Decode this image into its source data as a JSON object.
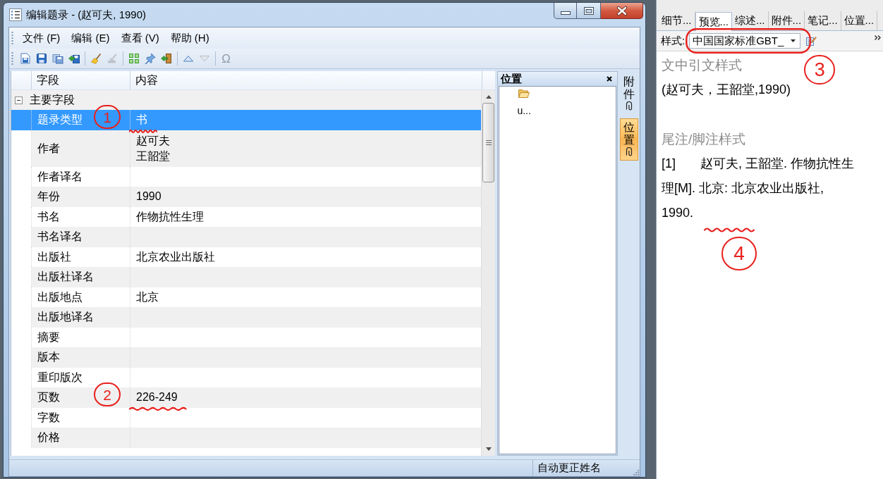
{
  "window": {
    "title": "编辑题录 - (赵可夫, 1990)"
  },
  "menu": [
    {
      "label": "文件 (F)"
    },
    {
      "label": "编辑 (E)"
    },
    {
      "label": "查看 (V)"
    },
    {
      "label": "帮助 (H)"
    }
  ],
  "toolbar": [
    {
      "kind": "new",
      "disabled": false
    },
    {
      "kind": "save",
      "disabled": false
    },
    {
      "kind": "copy",
      "disabled": false
    },
    {
      "kind": "saveclose",
      "disabled": false
    },
    {
      "kind": "separator"
    },
    {
      "kind": "clean",
      "disabled": false
    },
    {
      "kind": "stamp",
      "disabled": true
    },
    {
      "kind": "separator"
    },
    {
      "kind": "grid",
      "disabled": false
    },
    {
      "kind": "pin",
      "disabled": false
    },
    {
      "kind": "exit",
      "disabled": false
    },
    {
      "kind": "separator"
    },
    {
      "kind": "up",
      "disabled": false
    },
    {
      "kind": "down",
      "disabled": true
    },
    {
      "kind": "separator"
    },
    {
      "kind": "symbol",
      "glyph": "Ω",
      "disabled": true
    }
  ],
  "table": {
    "columns": [
      "字段",
      "内容"
    ],
    "group": {
      "label": "主要字段",
      "expanded": true
    },
    "rows": [
      {
        "field": "题录类型",
        "values": [
          "书"
        ],
        "selected": true,
        "annotation": "1"
      },
      {
        "field": "作者",
        "values": [
          "赵可夫",
          "王韶堂"
        ],
        "selected": false
      },
      {
        "field": "作者译名",
        "selected": false
      },
      {
        "field": "年份",
        "values": [
          "1990"
        ],
        "selected": false
      },
      {
        "field": "书名",
        "values": [
          "作物抗性生理"
        ],
        "selected": false
      },
      {
        "field": "书名译名",
        "selected": false
      },
      {
        "field": "出版社",
        "values": [
          "北京农业出版社"
        ],
        "selected": false
      },
      {
        "field": "出版社译名",
        "selected": false
      },
      {
        "field": "出版地点",
        "values": [
          "北京"
        ],
        "selected": false
      },
      {
        "field": "出版地译名",
        "selected": false
      },
      {
        "field": "摘要",
        "selected": false
      },
      {
        "field": "版本",
        "selected": false
      },
      {
        "field": "重印版次",
        "selected": false
      },
      {
        "field": "页数",
        "values": [
          "226-249"
        ],
        "selected": false,
        "annotation": "2"
      },
      {
        "field": "字数",
        "selected": false
      },
      {
        "field": "价格",
        "selected": false
      }
    ]
  },
  "location_panel": {
    "title": "位置",
    "items": [
      {
        "label": "u..."
      }
    ]
  },
  "side_tabs": [
    {
      "label": "附件",
      "selected": false
    },
    {
      "label": "位置",
      "selected": true
    }
  ],
  "status_bar": {
    "text": "自动更正姓名"
  },
  "preview": {
    "tabs": [
      {
        "label": "细节...",
        "selected": false
      },
      {
        "label": "预览...",
        "selected": true
      },
      {
        "label": "综述...",
        "selected": false
      },
      {
        "label": "附件...",
        "selected": false
      },
      {
        "label": "笔记...",
        "selected": false
      },
      {
        "label": "位置...",
        "selected": false
      }
    ],
    "style_label": "样式:",
    "style_value": "中国国家标准GBT_",
    "style_annotation": "3",
    "sections": [
      {
        "heading": "文中引文样式",
        "text": "(赵可夫，王韶堂,1990)"
      },
      {
        "heading": "尾注/脚注样式",
        "text": "[1]\t赵可夫, 王韶堂. 作物抗性生理[M]. 北京: 北京农业出版社, 1990.",
        "annotation": "4"
      }
    ]
  }
}
